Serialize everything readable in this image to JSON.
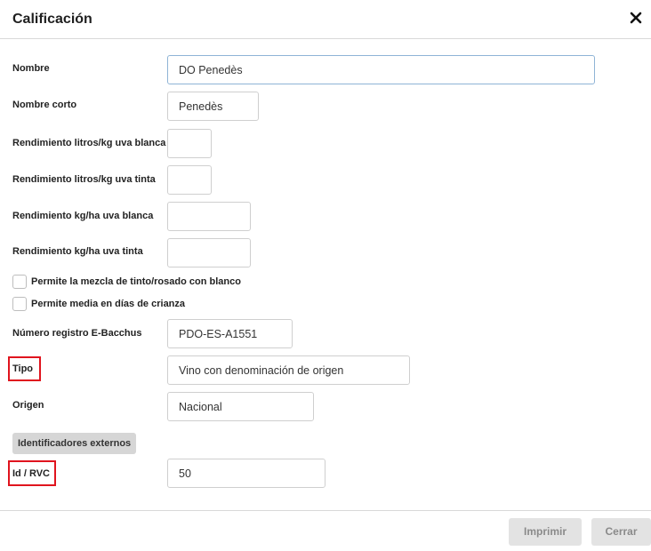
{
  "dialog": {
    "title": "Calificación"
  },
  "fields": {
    "nombre": {
      "label": "Nombre",
      "value": "DO Penedès"
    },
    "nombre_corto": {
      "label": "Nombre corto",
      "value": "Penedès"
    },
    "rend_litros_blanca": {
      "label": "Rendimiento litros/kg uva blanca",
      "value": ""
    },
    "rend_litros_tinta": {
      "label": "Rendimiento litros/kg uva tinta",
      "value": ""
    },
    "rend_kg_blanca": {
      "label": "Rendimiento kg/ha uva blanca",
      "value": ""
    },
    "rend_kg_tinta": {
      "label": "Rendimiento kg/ha uva tinta",
      "value": ""
    },
    "registro": {
      "label": "Número registro E-Bacchus",
      "value": "PDO-ES-A1551"
    },
    "tipo": {
      "label": "Tipo",
      "value": "Vino con denominación de origen"
    },
    "origen": {
      "label": "Origen",
      "value": "Nacional"
    },
    "id_rvc": {
      "label": "Id / RVC",
      "value": "50"
    }
  },
  "checkboxes": {
    "mezcla": {
      "label": "Permite la mezcla de tinto/rosado con blanco",
      "checked": false
    },
    "media": {
      "label": "Permite media en días de crianza",
      "checked": false
    }
  },
  "section": {
    "label": "Identificadores externos"
  },
  "footer": {
    "print_label": "Imprimir",
    "close_label": "Cerrar"
  },
  "icons": {
    "close": "close-icon"
  },
  "colors": {
    "highlight": "#e0141e",
    "focus_border": "#8fb4d6"
  }
}
